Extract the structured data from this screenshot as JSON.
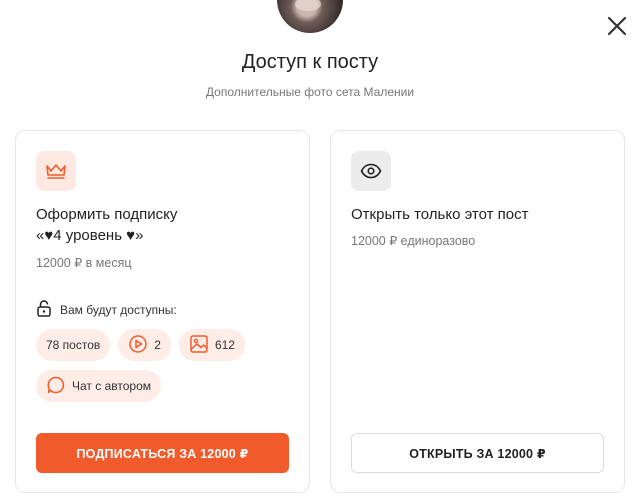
{
  "modal": {
    "title": "Доступ к посту",
    "subtitle": "Дополнительные фото сета Малении"
  },
  "subscription_card": {
    "title_line1": "Оформить подписку",
    "title_line2": "«♥4 уровень ♥»",
    "price_note": "12000 ₽ в месяц",
    "access_label": "Вам будут доступны:",
    "chips": {
      "posts": "78 постов",
      "videos": "2",
      "images": "612",
      "chat": "Чат с автором"
    },
    "button_label": "ПОДПИСАТЬСЯ ЗА 12000 ₽"
  },
  "single_post_card": {
    "title": "Открыть только этот пост",
    "price_note": "12000 ₽ единоразово",
    "button_label": "ОТКРЫТЬ ЗА 12000 ₽"
  },
  "colors": {
    "accent": "#f15a2b",
    "chip_bg": "#fdede6",
    "icon_peach": "#fde9e2"
  },
  "icons": [
    "close-icon",
    "crown-icon",
    "eye-icon",
    "lock-icon",
    "play-icon",
    "image-icon",
    "chat-icon"
  ]
}
